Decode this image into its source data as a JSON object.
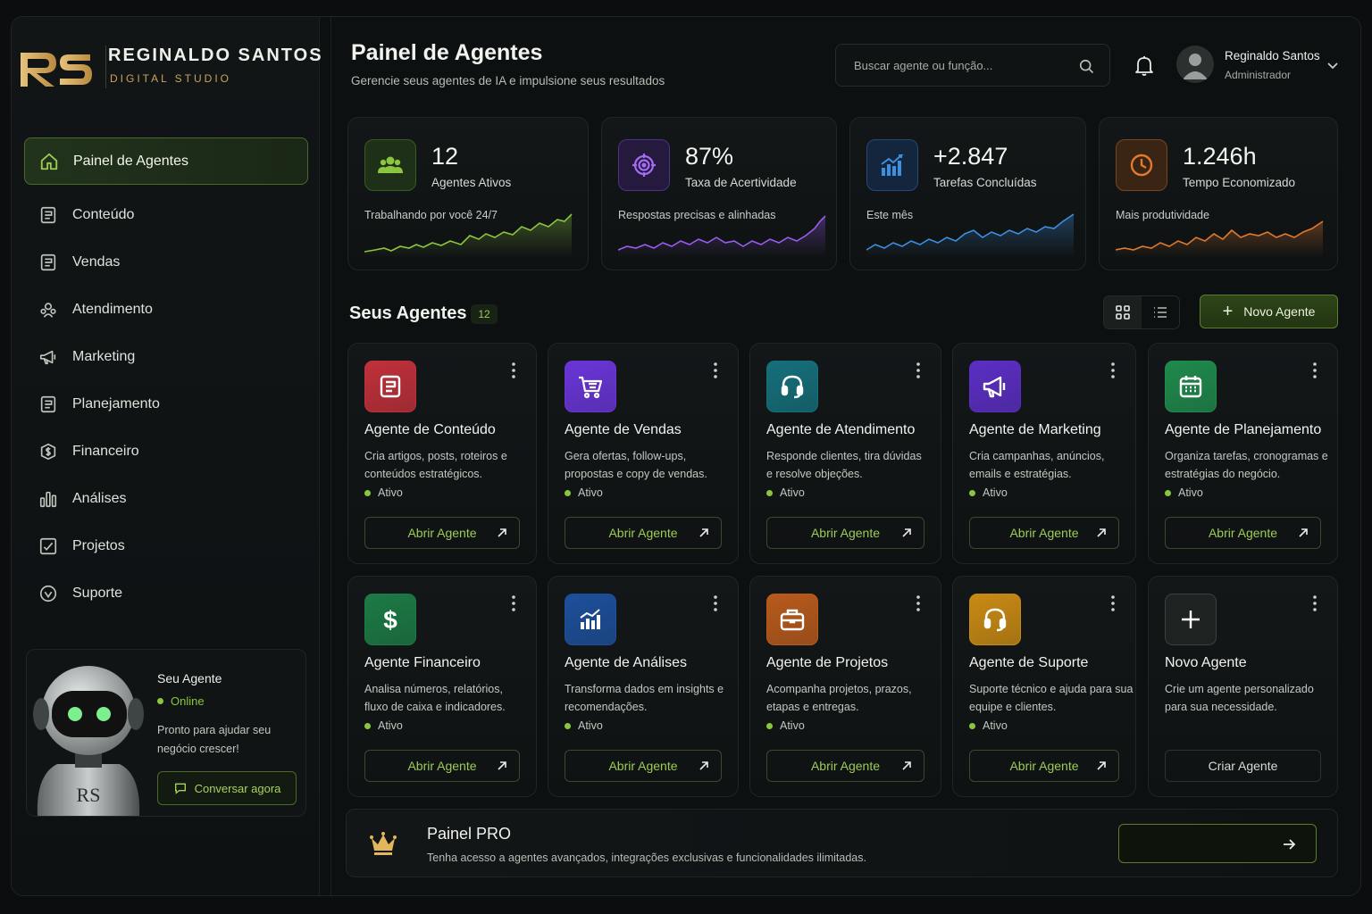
{
  "brand": {
    "name": "REGINALDO SANTOS",
    "subtitle": "DIGITAL STUDIO",
    "logo_text": "RS"
  },
  "header": {
    "title": "Painel de Agentes",
    "subtitle": "Gerencie seus agentes de IA e impulsione seus resultados",
    "search_placeholder": "Buscar agente ou função...",
    "user": {
      "name": "Reginaldo Santos",
      "role": "Administrador"
    }
  },
  "sidebar": {
    "items": [
      {
        "label": "Painel de Agentes",
        "icon": "home-icon",
        "active": true
      },
      {
        "label": "Conteúdo",
        "icon": "document-icon"
      },
      {
        "label": "Vendas",
        "icon": "document-icon"
      },
      {
        "label": "Atendimento",
        "icon": "users-gear-icon"
      },
      {
        "label": "Marketing",
        "icon": "megaphone-icon"
      },
      {
        "label": "Planejamento",
        "icon": "document-icon"
      },
      {
        "label": "Financeiro",
        "icon": "dollar-icon"
      },
      {
        "label": "Análises",
        "icon": "bar-chart-icon"
      },
      {
        "label": "Projetos",
        "icon": "checklist-icon"
      },
      {
        "label": "Suporte",
        "icon": "support-icon"
      }
    ],
    "agent_card": {
      "title": "Seu Agente",
      "status": "Online",
      "text": "Pronto para ajudar seu negócio crescer!",
      "button": "Conversar agora"
    }
  },
  "stats": [
    {
      "value": "12",
      "label": "Agentes Ativos",
      "note": "Trabalhando por você 24/7",
      "color": "#8cc63f",
      "icon": "users-icon"
    },
    {
      "value": "87%",
      "label": "Taxa de Acertividade",
      "note": "Respostas precisas e alinhadas",
      "color": "#9b5cf0",
      "icon": "target-icon"
    },
    {
      "value": "+2.847",
      "label": "Tarefas Concluídas",
      "note": "Este mês",
      "color": "#3d8fe0",
      "icon": "growth-chart-icon"
    },
    {
      "value": "1.246h",
      "label": "Tempo Economizado",
      "note": "Mais produtividade",
      "color": "#e07a2e",
      "icon": "clock-icon"
    }
  ],
  "agents_section": {
    "title": "Seus Agentes",
    "count": "12",
    "new_button": "Novo Agente"
  },
  "agents": [
    {
      "title": "Agente de Conteúdo",
      "desc": "Cria artigos, posts, roteiros e conteúdos estratégicos.",
      "status": "Ativo",
      "button": "Abrir Agente",
      "color": "#c0303a",
      "icon": "document-icon"
    },
    {
      "title": "Agente de Vendas",
      "desc": "Gera ofertas, follow-ups, propostas e copy de vendas.",
      "status": "Ativo",
      "button": "Abrir Agente",
      "color": "#6a35d8",
      "icon": "cart-icon"
    },
    {
      "title": "Agente de Atendimento",
      "desc": "Responde clientes, tira dúvidas e resolve objeções.",
      "status": "Ativo",
      "button": "Abrir Agente",
      "color": "#156f7a",
      "icon": "headset-icon"
    },
    {
      "title": "Agente de Marketing",
      "desc": "Cria campanhas, anúncios, emails e estratégias.",
      "status": "Ativo",
      "button": "Abrir Agente",
      "color": "#5b2ec4",
      "icon": "megaphone-icon"
    },
    {
      "title": "Agente de Planejamento",
      "desc": "Organiza tarefas, cronogramas e estratégias do negócio.",
      "status": "Ativo",
      "button": "Abrir Agente",
      "color": "#1f8a4c",
      "icon": "calendar-icon"
    },
    {
      "title": "Agente Financeiro",
      "desc": "Analisa números, relatórios, fluxo de caixa e indicadores.",
      "status": "Ativo",
      "button": "Abrir Agente",
      "color": "#1c7a45",
      "icon": "dollar-icon"
    },
    {
      "title": "Agente de Análises",
      "desc": "Transforma dados em insights e recomendações.",
      "status": "Ativo",
      "button": "Abrir Agente",
      "color": "#1d4f9a",
      "icon": "bar-chart-icon"
    },
    {
      "title": "Agente de Projetos",
      "desc": "Acompanha projetos, prazos, etapas e entregas.",
      "status": "Ativo",
      "button": "Abrir Agente",
      "color": "#b85a1c",
      "icon": "briefcase-icon"
    },
    {
      "title": "Agente de Suporte",
      "desc": "Suporte técnico e ajuda para sua equipe e clientes.",
      "status": "Ativo",
      "button": "Abrir Agente",
      "color": "#c98a14",
      "icon": "headset-icon"
    },
    {
      "title": "Novo Agente",
      "desc": "Crie um agente personalizado para sua necessidade.",
      "status": "",
      "button": "Criar Agente",
      "color": "#1e2322",
      "icon": "plus-icon"
    }
  ],
  "pro": {
    "title": "Painel PRO",
    "subtitle": "Tenha acesso a agentes avançados, integrações exclusivas e funcionalidades  ilimitadas."
  }
}
